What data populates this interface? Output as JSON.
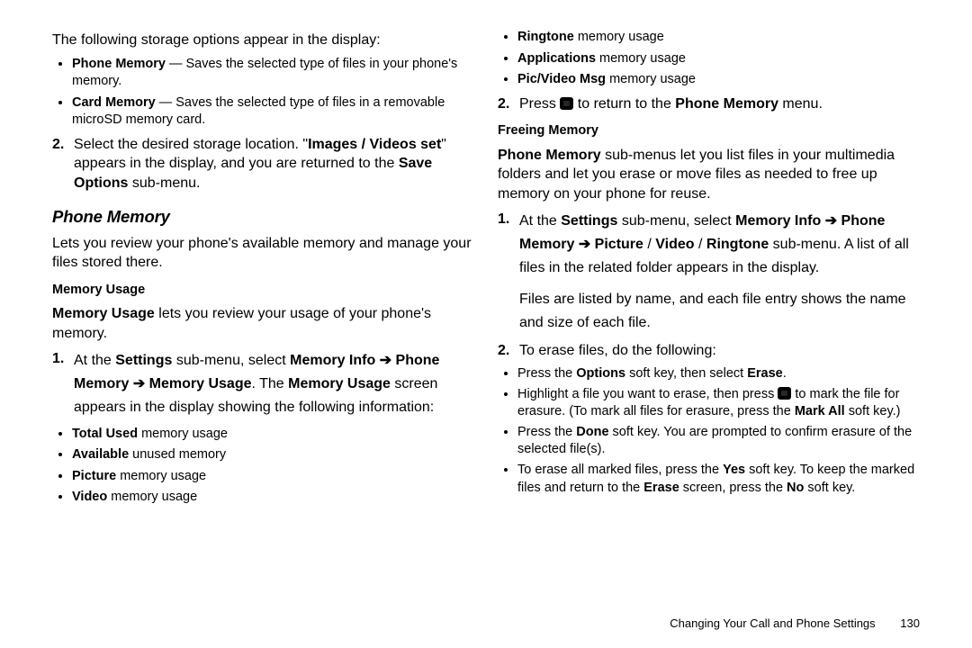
{
  "left": {
    "intro": "The following storage options appear in the display:",
    "bullets1": [
      {
        "label": "Phone Memory",
        "desc": " — Saves the selected type of files in your phone's memory."
      },
      {
        "label": "Card Memory",
        "desc": " — Saves the selected type of files in a removable microSD memory card."
      }
    ],
    "step2a": "Select the desired storage location. \"",
    "step2b": "Images / Videos set",
    "step2c": "\" appears in the display, and you are returned to the ",
    "step2d": "Save Options",
    "step2e": " sub-menu.",
    "sec_title": "Phone Memory",
    "sec_intro": "Lets you review your phone's available memory and manage your files stored there.",
    "sub1": "Memory Usage",
    "mu_intro_b": "Memory Usage",
    "mu_intro_rest": " lets you review your usage of your phone's memory.",
    "mu_step1a": "At the ",
    "mu_step1b": "Settings",
    "mu_step1c": " sub-menu, select ",
    "mu_step1d": "Memory Info",
    "mu_step1e": "Phone Memory",
    "mu_step1f": "Memory Usage",
    "mu_step1g": ". The ",
    "mu_step1h": "Memory Usage",
    "mu_step1i": " screen appears in the display showing the following information:",
    "mu_bullets_l": [
      {
        "b": "Total Used",
        "t": " memory usage"
      },
      {
        "b": "Available",
        "t": " unused memory"
      },
      {
        "b": "Picture",
        "t": " memory usage"
      },
      {
        "b": "Video",
        "t": " memory usage"
      }
    ]
  },
  "right": {
    "mu_bullets_r": [
      {
        "b": "Ringtone",
        "t": " memory usage"
      },
      {
        "b": "Applications",
        "t": " memory usage"
      },
      {
        "b": "Pic/Video Msg",
        "t": " memory usage"
      }
    ],
    "mu_step2a": "Press ",
    "mu_step2b": " to return to the ",
    "mu_step2c": "Phone Memory",
    "mu_step2d": " menu.",
    "sub2": "Freeing Memory",
    "fm_intro_b": "Phone Memory",
    "fm_intro_rest": " sub-menus let you list files in your multimedia folders and let you erase or move files as needed to free up memory on your phone for reuse.",
    "fm1_a": "At the ",
    "fm1_b": "Settings",
    "fm1_c": " sub-menu, select ",
    "fm1_d": "Memory Info",
    "fm1_e": "Phone Memory",
    "fm1_f": "Picture",
    "fm1_g": "Video",
    "fm1_h": "Ringtone",
    "fm1_i": " sub-menu. A list of all files in the related folder appears in the display.",
    "fm1_tail": "Files are listed by name, and each file entry shows the name and size of each file.",
    "fm2_lead": "To erase files, do the following:",
    "fm2_b1a": "Press the ",
    "fm2_b1b": "Options",
    "fm2_b1c": " soft key, then select ",
    "fm2_b1d": "Erase",
    "fm2_b1e": ".",
    "fm2_b2a": "Highlight a file you want to erase, then press ",
    "fm2_b2b": " to mark the file for erasure. (To mark all files for erasure, press the ",
    "fm2_b2c": "Mark All",
    "fm2_b2d": " soft key.)",
    "fm2_b3a": "Press the ",
    "fm2_b3b": "Done",
    "fm2_b3c": " soft key. You are prompted to confirm erasure of the selected file(s).",
    "fm2_b4a": "To erase all marked files, press the ",
    "fm2_b4b": "Yes",
    "fm2_b4c": " soft key. To keep the marked files and return to the ",
    "fm2_b4d": "Erase",
    "fm2_b4e": " screen, press the ",
    "fm2_b4f": "No",
    "fm2_b4g": " soft key."
  },
  "labels": {
    "num2": "2.",
    "num1": "1.",
    "arrow": "➔",
    "slash": " / "
  },
  "footer": {
    "chapter": "Changing Your Call and Phone Settings",
    "page": "130"
  }
}
